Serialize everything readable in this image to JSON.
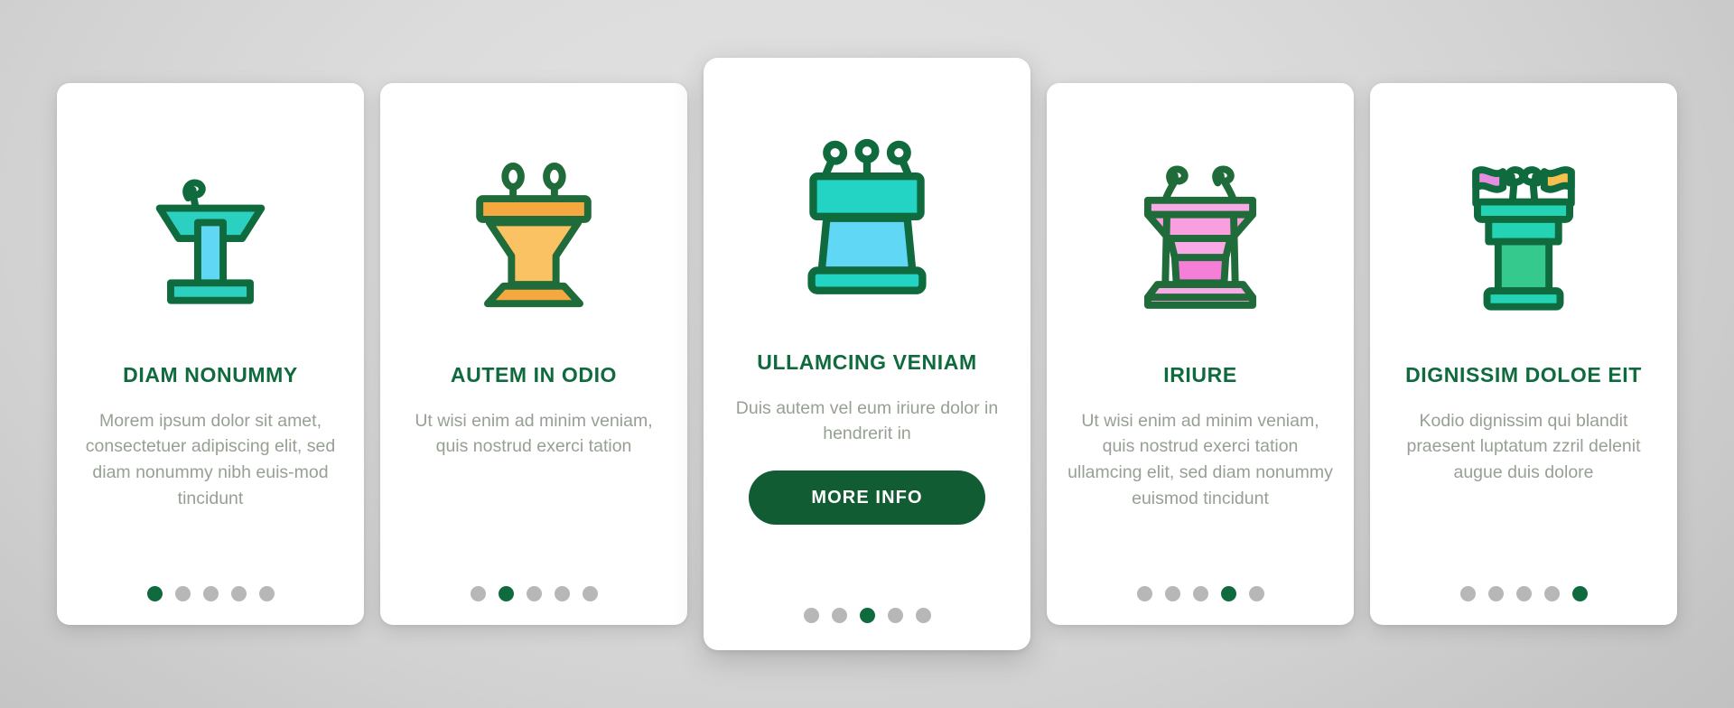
{
  "background": {
    "color_top": "#e2e2e2",
    "color_bottom": "#bfbfbf"
  },
  "theme": {
    "title_color": "#0f6b3d",
    "body_color": "#97a094",
    "button_color": "#125c34",
    "dot_active_color": "#0f6b3d",
    "dot_inactive_color": "#b7b7b7",
    "outline_color": "#0f6b3d",
    "card_background": "#ffffff"
  },
  "cards": [
    {
      "icon_name": "podium-speaker-stand-icon",
      "icon_colors": {
        "top": "#2bd0c0",
        "column": "#5fd7f5",
        "base": "#2bd0c0",
        "outline": "#0f6b3d"
      },
      "title": "DIAM NONUMMY",
      "body": "Morem ipsum dolor sit amet, consectetuer adipiscing elit, sed diam nonummy nibh euis-mod tincidunt",
      "has_button": false,
      "button_label": "",
      "dots": {
        "count": 5,
        "active_index": 0
      },
      "featured": false
    },
    {
      "icon_name": "podium-two-microphones-icon",
      "icon_colors": {
        "top": "#f5a83f",
        "column": "#fbc264",
        "base": "#f5a83f",
        "outline": "#1f6b3a"
      },
      "title": "AUTEM IN ODIO",
      "body": "Ut wisi enim ad minim veniam, quis nostrud exerci tation",
      "has_button": false,
      "button_label": "",
      "dots": {
        "count": 5,
        "active_index": 1
      },
      "featured": false
    },
    {
      "icon_name": "podium-three-microphones-icon",
      "icon_colors": {
        "top": "#23d3c4",
        "column": "#5fd7f5",
        "base": "#23d3c4",
        "outline": "#0f6b3d"
      },
      "title": "ULLAMCING VENIAM",
      "body": "Duis autem vel eum iriure dolor in hendrerit in",
      "has_button": true,
      "button_label": "MORE INFO",
      "dots": {
        "count": 5,
        "active_index": 2
      },
      "featured": true
    },
    {
      "icon_name": "podium-pink-rostrum-icon",
      "icon_colors": {
        "top": "#f99fe0",
        "column": "#f57fd8",
        "base": "#f9aae6",
        "outline": "#1f6b3a"
      },
      "title": "IRIURE",
      "body": "Ut wisi enim ad minim veniam, quis nostrud exerci tation ullamcing elit, sed diam nonummy euismod tincidunt",
      "has_button": false,
      "button_label": "",
      "dots": {
        "count": 5,
        "active_index": 3
      },
      "featured": false
    },
    {
      "icon_name": "podium-with-flags-icon",
      "icon_colors": {
        "top": "#23d3b4",
        "column": "#35c98e",
        "base": "#23d3b4",
        "outline": "#0f6b3d",
        "flag_left": "#e58de0",
        "flag_right": "#f5c04f"
      },
      "title": "DIGNISSIM DOLOE EIT",
      "body": "Kodio dignissim qui blandit praesent luptatum zzril delenit augue duis dolore",
      "has_button": false,
      "button_label": "",
      "dots": {
        "count": 5,
        "active_index": 4
      },
      "featured": false
    }
  ]
}
